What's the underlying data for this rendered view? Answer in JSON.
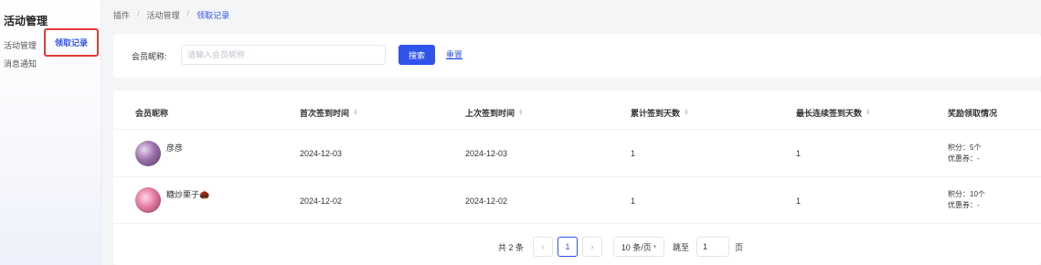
{
  "sidebar": {
    "title": "活动管理",
    "items": [
      {
        "label": "活动管理"
      },
      {
        "label": "领取记录"
      },
      {
        "label": "消息通知"
      }
    ]
  },
  "breadcrumb": [
    "插件",
    "活动管理",
    "领取记录"
  ],
  "search": {
    "label": "会员昵称:",
    "placeholder": "请输入会员昵称",
    "search_button": "搜索",
    "reset_button": "重置"
  },
  "table": {
    "columns": [
      "会员昵称",
      "首次签到时间",
      "上次签到时间",
      "累计签到天数",
      "最长连续签到天数",
      "奖励领取情况"
    ],
    "rows": [
      {
        "nickname": "彦彦",
        "first_checkin": "2024-12-03",
        "last_checkin": "2024-12-03",
        "total_days": "1",
        "max_streak": "1",
        "reward_points": "积分：5个",
        "reward_coupon": "优惠券：-"
      },
      {
        "nickname": "糖炒栗子🌰",
        "first_checkin": "2024-12-02",
        "last_checkin": "2024-12-02",
        "total_days": "1",
        "max_streak": "1",
        "reward_points": "积分：10个",
        "reward_coupon": "优惠券：-"
      }
    ]
  },
  "pagination": {
    "total": "共 2 条",
    "prev": "‹",
    "current_page": "1",
    "next": "›",
    "page_size": "10 条/页",
    "jump_label": "跳至",
    "jump_value": "1",
    "page_label": "页"
  },
  "colors": {
    "accent": "#2f54eb",
    "highlight_border": "#e53935"
  }
}
